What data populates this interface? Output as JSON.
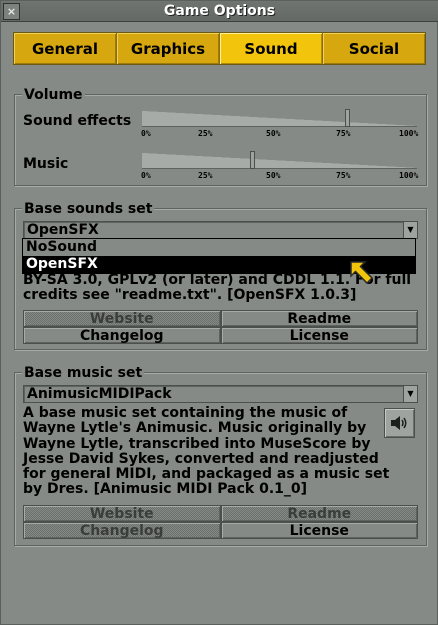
{
  "window": {
    "title": "Game Options",
    "close_label": "×"
  },
  "tabs": [
    {
      "label": "General",
      "active": false
    },
    {
      "label": "Graphics",
      "active": false
    },
    {
      "label": "Sound",
      "active": true
    },
    {
      "label": "Social",
      "active": false
    }
  ],
  "volume": {
    "title": "Volume",
    "ticks": [
      "0%",
      "25%",
      "50%",
      "75%",
      "100%"
    ],
    "sound_effects": {
      "label": "Sound effects",
      "value_percent": 75
    },
    "music": {
      "label": "Music",
      "value_percent": 40
    }
  },
  "base_sounds": {
    "title": "Base sounds set",
    "selected": "OpenSFX",
    "options": [
      "NoSound",
      "OpenSFX"
    ],
    "highlighted_option": "OpenSFX",
    "description": "BY-SA 3.0, GPLv2 (or later) and CDDL 1.1. For full\ncredits see \"readme.txt\". [OpenSFX 1.0.3]",
    "buttons": {
      "website": "Website",
      "readme": "Readme",
      "changelog": "Changelog",
      "license": "License"
    }
  },
  "base_music": {
    "title": "Base music set",
    "selected": "AnimusicMIDIPack",
    "description": "A base music set containing the music of\nWayne Lytle's Animusic. Music originally by\nWayne Lytle, transcribed into MuseScore by\nJesse David Sykes, converted and readjusted\nfor general MIDI, and packaged as a music set\nby Dres. [Animusic MIDI Pack 0.1_0]",
    "buttons": {
      "website": "Website",
      "readme": "Readme",
      "changelog": "Changelog",
      "license": "License"
    }
  },
  "colors": {
    "accent": "#f2c40b",
    "tab": "#d7a70f",
    "background": "#858a86",
    "cursor": "#f2c40b"
  }
}
